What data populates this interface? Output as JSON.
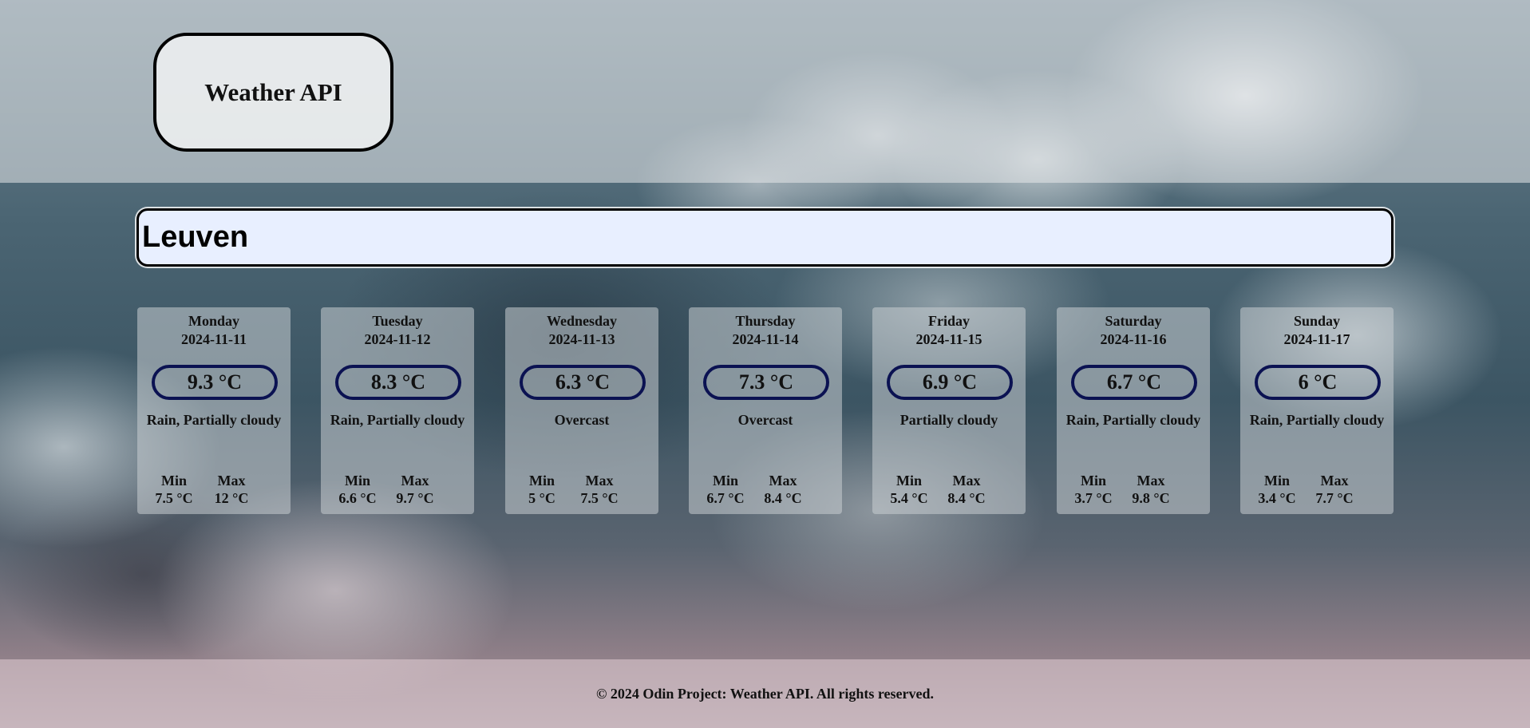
{
  "header": {
    "title": "Weather API"
  },
  "search": {
    "value": "Leuven"
  },
  "forecast": [
    {
      "day": "Monday",
      "date": "2024-11-11",
      "temp": "9.3 °C",
      "conditions": "Rain, Partially cloudy",
      "min_label": "Min",
      "max_label": "Max",
      "min": "7.5 °C",
      "max": "12 °C"
    },
    {
      "day": "Tuesday",
      "date": "2024-11-12",
      "temp": "8.3 °C",
      "conditions": "Rain, Partially cloudy",
      "min_label": "Min",
      "max_label": "Max",
      "min": "6.6 °C",
      "max": "9.7 °C"
    },
    {
      "day": "Wednesday",
      "date": "2024-11-13",
      "temp": "6.3 °C",
      "conditions": "Overcast",
      "min_label": "Min",
      "max_label": "Max",
      "min": "5 °C",
      "max": "7.5 °C"
    },
    {
      "day": "Thursday",
      "date": "2024-11-14",
      "temp": "7.3 °C",
      "conditions": "Overcast",
      "min_label": "Min",
      "max_label": "Max",
      "min": "6.7 °C",
      "max": "8.4 °C"
    },
    {
      "day": "Friday",
      "date": "2024-11-15",
      "temp": "6.9 °C",
      "conditions": "Partially cloudy",
      "min_label": "Min",
      "max_label": "Max",
      "min": "5.4 °C",
      "max": "8.4 °C"
    },
    {
      "day": "Saturday",
      "date": "2024-11-16",
      "temp": "6.7 °C",
      "conditions": "Rain, Partially cloudy",
      "min_label": "Min",
      "max_label": "Max",
      "min": "3.7 °C",
      "max": "9.8 °C"
    },
    {
      "day": "Sunday",
      "date": "2024-11-17",
      "temp": "6 °C",
      "conditions": "Rain, Partially cloudy",
      "min_label": "Min",
      "max_label": "Max",
      "min": "3.4 °C",
      "max": "7.7 °C"
    }
  ],
  "footer": {
    "text": "© 2024 Odin Project: Weather API. All rights reserved."
  },
  "colors": {
    "temp_border": "#0b1252",
    "search_background": "#e8efff"
  }
}
